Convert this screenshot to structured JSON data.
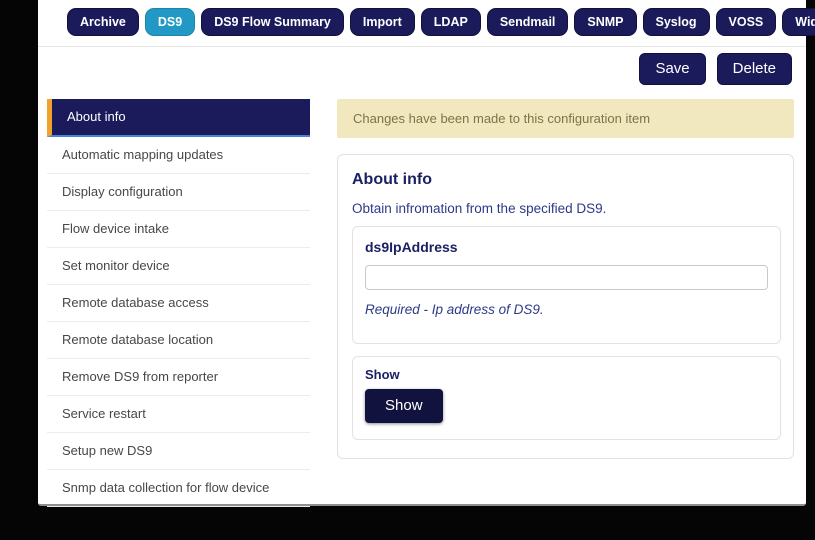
{
  "tab_bar": {
    "active_tab": "DS9",
    "tabs": [
      {
        "label": "Archive"
      },
      {
        "label": "DS9"
      },
      {
        "label": "DS9 Flow Summary"
      },
      {
        "label": "Import"
      },
      {
        "label": "LDAP"
      },
      {
        "label": "Sendmail"
      },
      {
        "label": "SNMP"
      },
      {
        "label": "Syslog"
      },
      {
        "label": "VOSS"
      },
      {
        "label": "Widget Resources"
      }
    ]
  },
  "toolbar": {
    "save_label": "Save",
    "delete_label": "Delete"
  },
  "sidebar": {
    "selected_item": "About info",
    "items": [
      {
        "label": "About info"
      },
      {
        "label": "Automatic mapping updates"
      },
      {
        "label": "Display configuration"
      },
      {
        "label": "Flow device intake"
      },
      {
        "label": "Set monitor device"
      },
      {
        "label": "Remote database access"
      },
      {
        "label": "Remote database location"
      },
      {
        "label": "Remove DS9 from reporter"
      },
      {
        "label": "Service restart"
      },
      {
        "label": "Setup new DS9"
      },
      {
        "label": "Snmp data collection for flow device"
      }
    ]
  },
  "alert": {
    "message": "Changes have been made to this configuration item"
  },
  "main": {
    "title": "About info",
    "description": "Obtain infromation from the specified DS9.",
    "fields": [
      {
        "label": "ds9IpAddress",
        "value": "",
        "help": "Required - Ip address of DS9."
      }
    ],
    "show_section": {
      "label": "Show",
      "button_label": "Show"
    }
  },
  "colors": {
    "navy": "#1b1b5c",
    "active_tab_cyan": "#2299c4",
    "selected_accent_orange": "#f0a22c",
    "selected_underline_blue": "#4a82d8",
    "alert_background": "#f1e8c0",
    "alert_text": "#7d7344",
    "heading_navy": "#1b2162",
    "body_blue": "#2c3a87"
  }
}
